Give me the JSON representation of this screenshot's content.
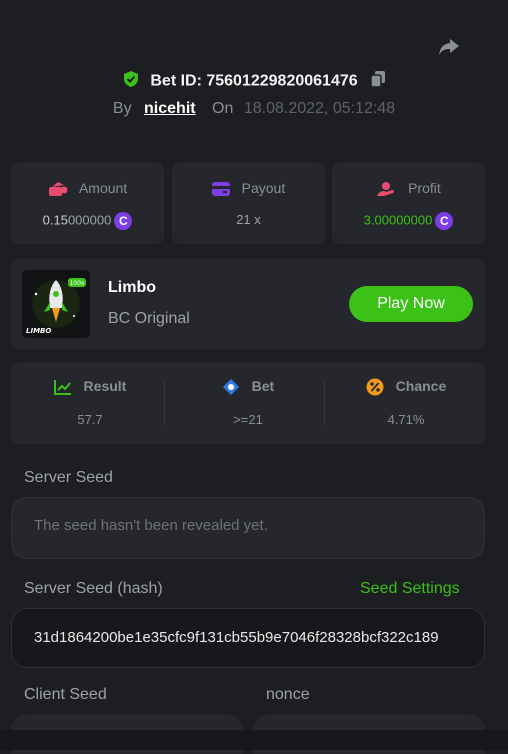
{
  "header": {
    "bet_id": "Bet ID: 75601229820061476",
    "by_label": "By",
    "user": "nicehit",
    "on_label": "On",
    "timestamp": "18.08.2022, 05:12:48"
  },
  "stats": {
    "amount": {
      "label": "Amount",
      "value_prefix": "0.15",
      "value_suffix": "000000"
    },
    "payout": {
      "label": "Payout",
      "value": "21 x"
    },
    "profit": {
      "label": "Profit",
      "value_prefix": "3.",
      "value_suffix": "00000000"
    }
  },
  "game": {
    "name": "Limbo",
    "subtitle": "BC Original",
    "thumb_tag": "LIMBO",
    "thumb_badge": "100x",
    "play_label": "Play Now"
  },
  "result": {
    "result": {
      "label": "Result",
      "value": "57.7"
    },
    "bet": {
      "label": "Bet",
      "value": ">=21"
    },
    "chance": {
      "label": "Chance",
      "value": "4.71%"
    }
  },
  "seeds": {
    "server_seed_label": "Server Seed",
    "server_seed_value": "The seed hasn't been revealed yet.",
    "server_hash_label": "Server Seed (hash)",
    "seed_settings_label": "Seed Settings",
    "server_hash_value": "31d1864200be1e35cfc9f131cb55b9e7046f28328bcf322c189",
    "client_seed_label": "Client Seed",
    "nonce_label": "nonce"
  },
  "colors": {
    "accent_green": "#3bc117",
    "coin_purple": "#7b3fe4",
    "panel": "#25272c",
    "background": "#1c1e22"
  },
  "icons": {
    "share": "share-icon",
    "verified": "shield-check-icon",
    "copy": "copy-icon",
    "coin": "coin-icon",
    "amount": "amount-icon",
    "payout": "wallet-icon",
    "profit": "profit-icon",
    "result": "result-chart-icon",
    "bet": "bet-icon",
    "chance": "percent-icon"
  },
  "coin_symbol": "C"
}
